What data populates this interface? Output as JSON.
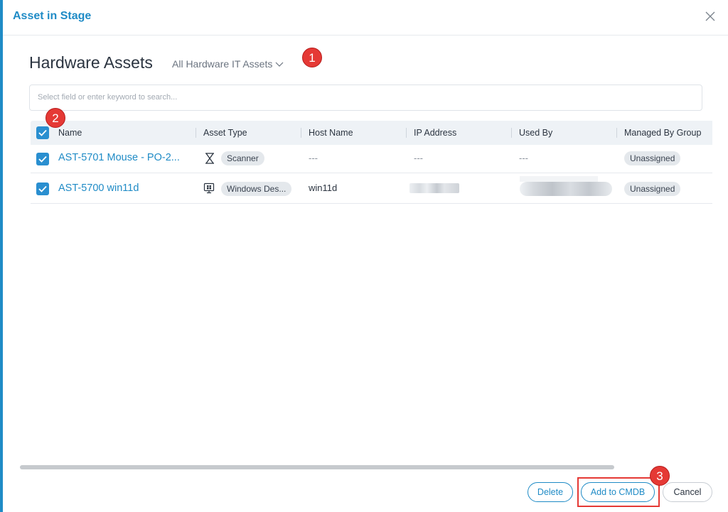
{
  "modal": {
    "title": "Asset in Stage",
    "close_icon": "close-icon"
  },
  "page": {
    "title": "Hardware Assets",
    "filter_label": "All Hardware IT Assets"
  },
  "search": {
    "placeholder": "Select field or enter keyword to search..."
  },
  "table": {
    "columns": [
      "Name",
      "Asset Type",
      "Host Name",
      "IP Address",
      "Used By",
      "Managed By Group"
    ],
    "rows": [
      {
        "name": "AST-5701 Mouse - PO-2...",
        "asset_type": "Scanner",
        "asset_icon": "scanner-icon",
        "host_name": "---",
        "ip_address": "---",
        "used_by": "---",
        "managed_by_group": "Unassigned",
        "checked": true
      },
      {
        "name": "AST-5700 win11d",
        "asset_type": "Windows Des...",
        "asset_icon": "desktop-icon",
        "host_name": "win11d",
        "ip_address": "",
        "used_by": "",
        "managed_by_group": "Unassigned",
        "checked": true
      }
    ]
  },
  "annotations": [
    "1",
    "2",
    "3"
  ],
  "footer": {
    "delete_label": "Delete",
    "add_cmdb_label": "Add to CMDB",
    "cancel_label": "Cancel"
  },
  "colors": {
    "accent": "#1f8bc6",
    "checkbox": "#2a8fd0",
    "badge_red": "#e53935"
  }
}
